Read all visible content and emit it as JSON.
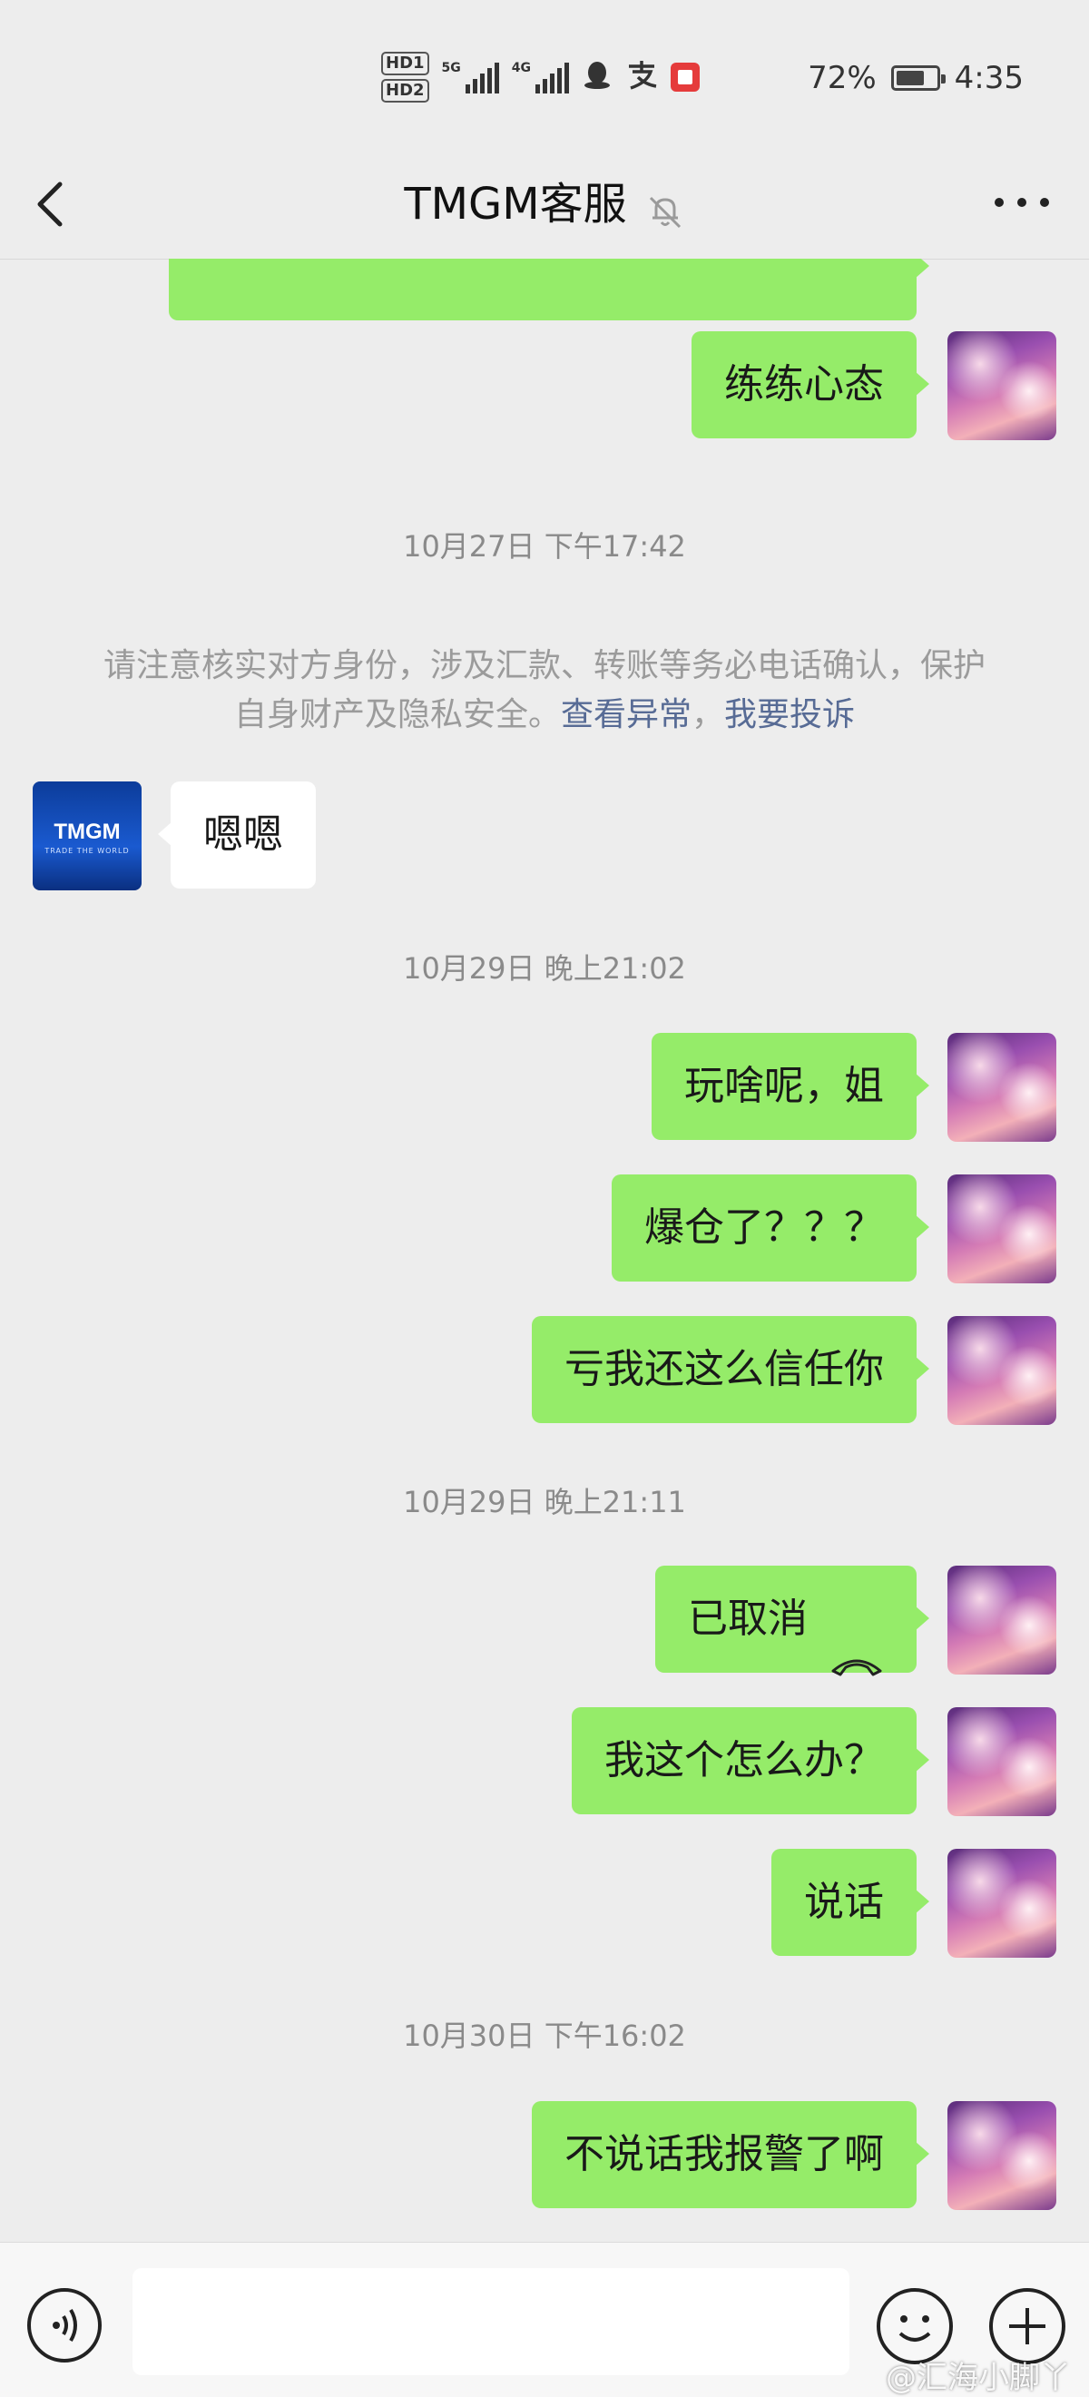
{
  "status_bar": {
    "hd1": "HD1",
    "hd2": "HD2",
    "net1": "5G",
    "net2": "4G",
    "battery_percent": "72%",
    "battery_level": 0.72,
    "time": "4:35"
  },
  "header": {
    "title": "TMGM客服",
    "icons": [
      "back-icon",
      "mute-bell-icon",
      "more-icon"
    ]
  },
  "messages": [
    {
      "side": "me",
      "text": "练练心态"
    },
    {
      "type": "timestamp",
      "text": "10月27日 下午17:42"
    },
    {
      "type": "notice",
      "text": "请注意核实对方身份，涉及汇款、转账等务必电话确认，保护自身财产及隐私安全。",
      "link1": "查看异常",
      "sep": "，",
      "link2": "我要投诉"
    },
    {
      "side": "them",
      "text": "嗯嗯",
      "avatar_text": "TMGM",
      "avatar_subtext": "TRADE THE WORLD"
    },
    {
      "type": "timestamp",
      "text": "10月29日 晚上21:02"
    },
    {
      "side": "me",
      "text": "玩啥呢，姐"
    },
    {
      "side": "me",
      "text": "爆仓了？？？"
    },
    {
      "side": "me",
      "text": "亏我还这么信任你"
    },
    {
      "type": "timestamp",
      "text": "10月29日 晚上21:11"
    },
    {
      "side": "me",
      "text": "已取消",
      "icon": "hangup-icon"
    },
    {
      "side": "me",
      "text": "我这个怎么办？"
    },
    {
      "side": "me",
      "text": "说话"
    },
    {
      "type": "timestamp",
      "text": "10月30日 下午16:02"
    },
    {
      "side": "me",
      "text": "不说话我报警了啊"
    }
  ],
  "input_bar": {
    "value": "",
    "icons": [
      "voice-icon",
      "emoji-icon",
      "plus-icon"
    ]
  },
  "watermark": "@汇海小脚丫"
}
